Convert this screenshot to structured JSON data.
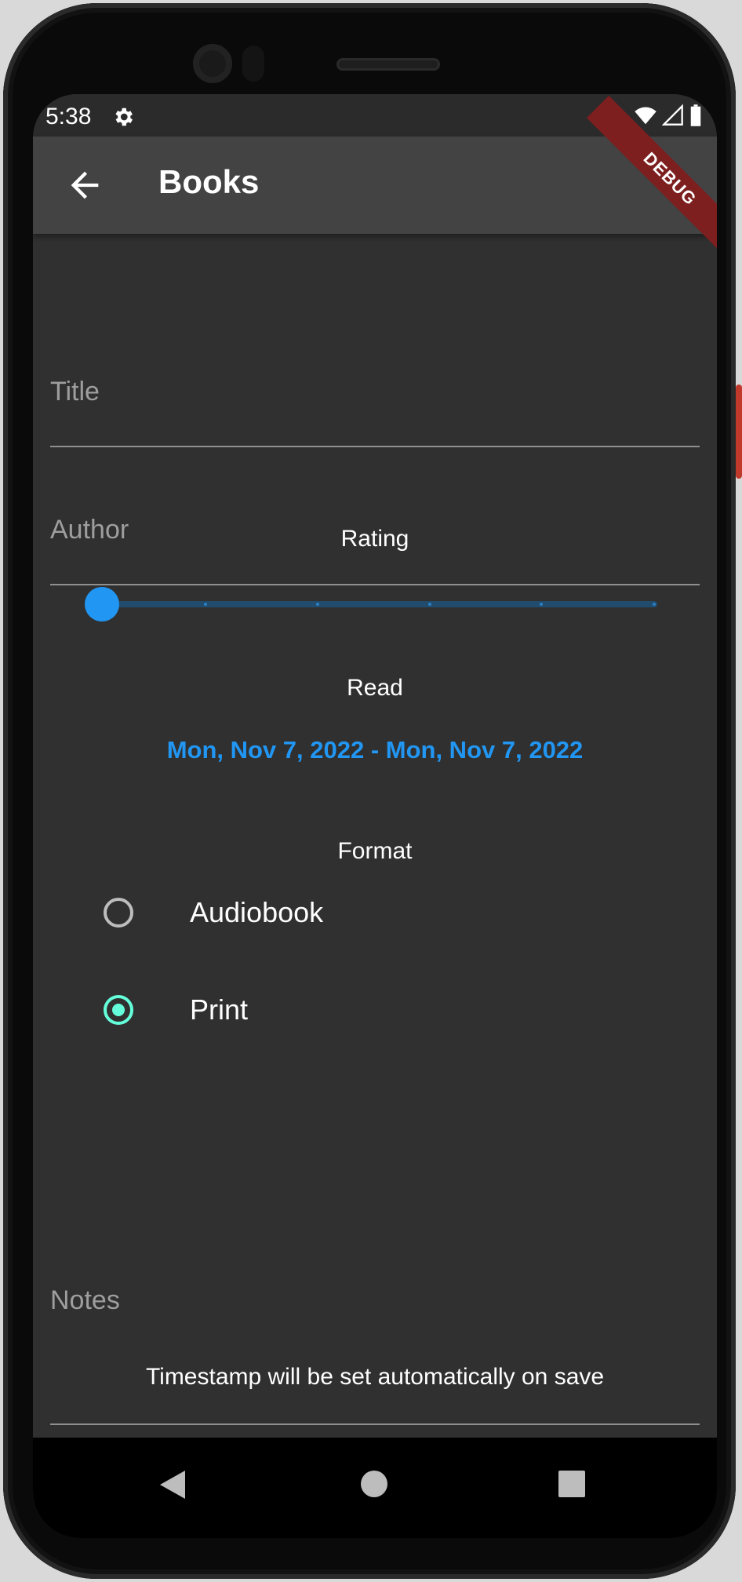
{
  "status_bar": {
    "time": "5:38",
    "icons": [
      "gear-icon",
      "wifi-icon",
      "signal-icon",
      "battery-icon"
    ]
  },
  "app_bar": {
    "title": "Books",
    "back_icon": "arrow-left-icon",
    "debug_banner": "DEBUG"
  },
  "form": {
    "title_field": {
      "label": "Title",
      "value": ""
    },
    "author_field": {
      "label": "Author",
      "value": ""
    },
    "rating": {
      "label": "Rating",
      "value": 0,
      "min": 0,
      "max": 5,
      "divisions": 5
    },
    "read": {
      "label": "Read",
      "range": "Mon, Nov 7, 2022 - Mon, Nov 7, 2022"
    },
    "format": {
      "label": "Format",
      "options": [
        {
          "label": "Audiobook",
          "selected": false
        },
        {
          "label": "Print",
          "selected": true
        }
      ]
    },
    "notes_field": {
      "label": "Notes",
      "value": ""
    },
    "timestamp_note": "Timestamp will be set automatically on save"
  },
  "colors": {
    "accent": "#2196f3",
    "radio_active": "#64ffda",
    "background": "#303030",
    "appbar": "#434343"
  },
  "nav_bar": {
    "icons": [
      "nav-back-icon",
      "nav-home-icon",
      "nav-recent-icon"
    ]
  }
}
